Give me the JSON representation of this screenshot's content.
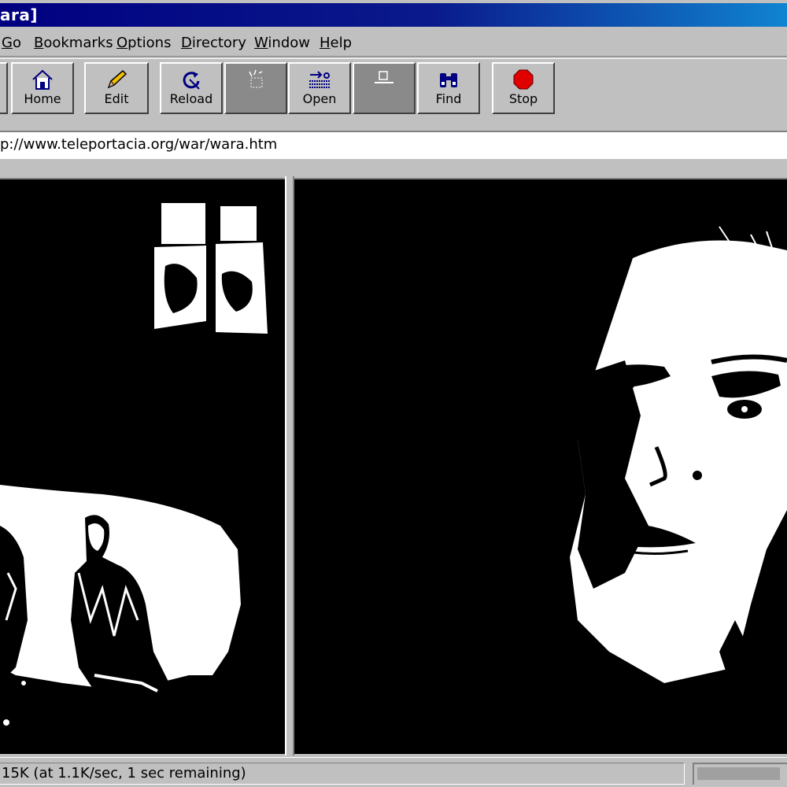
{
  "window": {
    "title": "ara]"
  },
  "menu": {
    "items": [
      {
        "label": "Go",
        "ul": "G",
        "rest": "o"
      },
      {
        "label": "Bookmarks",
        "ul": "B",
        "rest": "ookmarks"
      },
      {
        "label": "Options",
        "ul": "O",
        "rest": "ptions"
      },
      {
        "label": "Directory",
        "ul": "D",
        "rest": "irectory"
      },
      {
        "label": "Window",
        "ul": "W",
        "rest": "indow"
      },
      {
        "label": "Help",
        "ul": "H",
        "rest": "elp"
      }
    ]
  },
  "toolbar": {
    "home_label": "Home",
    "edit_label": "Edit",
    "reload_label": "Reload",
    "open_label": "Open",
    "find_label": "Find",
    "stop_label": "Stop"
  },
  "location": {
    "url": "p://www.teleportacia.org/war/wara.htm"
  },
  "status": {
    "text": "15K (at 1.1K/sec, 1 sec remaining)",
    "progress_percent": 95
  },
  "colors": {
    "titlebar_start": "#000080",
    "titlebar_end": "#1084d0",
    "chrome": "#c0c0c0",
    "stop_red": "#e00000"
  }
}
